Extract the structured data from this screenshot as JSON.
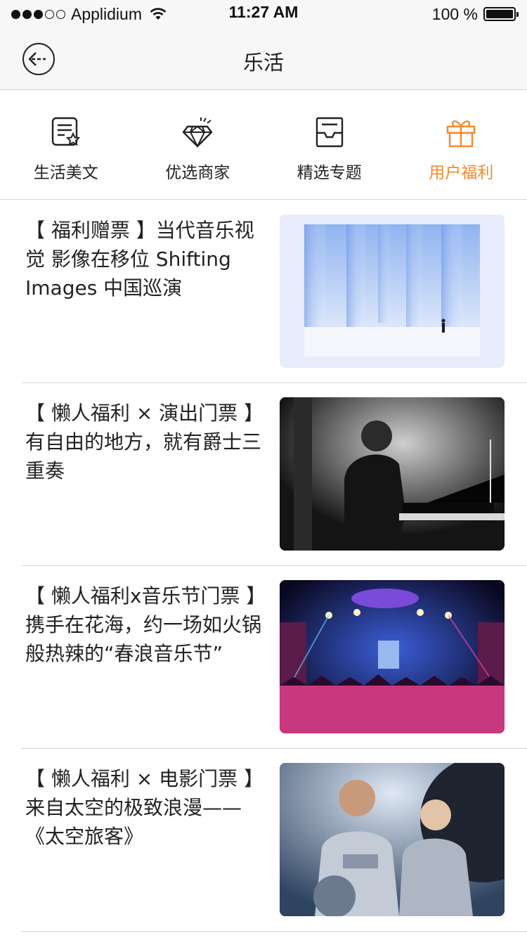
{
  "status_bar": {
    "carrier": "Applidium",
    "time": "11:27 AM",
    "battery": "100 %"
  },
  "nav": {
    "title": "乐活",
    "back_icon": "back-arrow-circle-icon"
  },
  "tabs": [
    {
      "label": "生活美文",
      "icon": "article-star-icon",
      "active": false
    },
    {
      "label": "优选商家",
      "icon": "diamond-icon",
      "active": false
    },
    {
      "label": "精选专题",
      "icon": "inbox-tray-icon",
      "active": false
    },
    {
      "label": "用户福利",
      "icon": "gift-icon",
      "active": true
    }
  ],
  "accent_color": "#f28a2e",
  "articles": [
    {
      "title": "【 福利赠票 】当代音乐视觉 影像在移位 Shifting Images 中国巡演"
    },
    {
      "title": "【 懒人福利 × 演出门票 】有自由的地方，就有爵士三重奏"
    },
    {
      "title": "【 懒人福利x音乐节门票 】携手在花海，约一场如火锅般热辣的“春浪音乐节”"
    },
    {
      "title": "【 懒人福利 × 电影门票 】来自太空的极致浪漫——《太空旅客》"
    }
  ]
}
